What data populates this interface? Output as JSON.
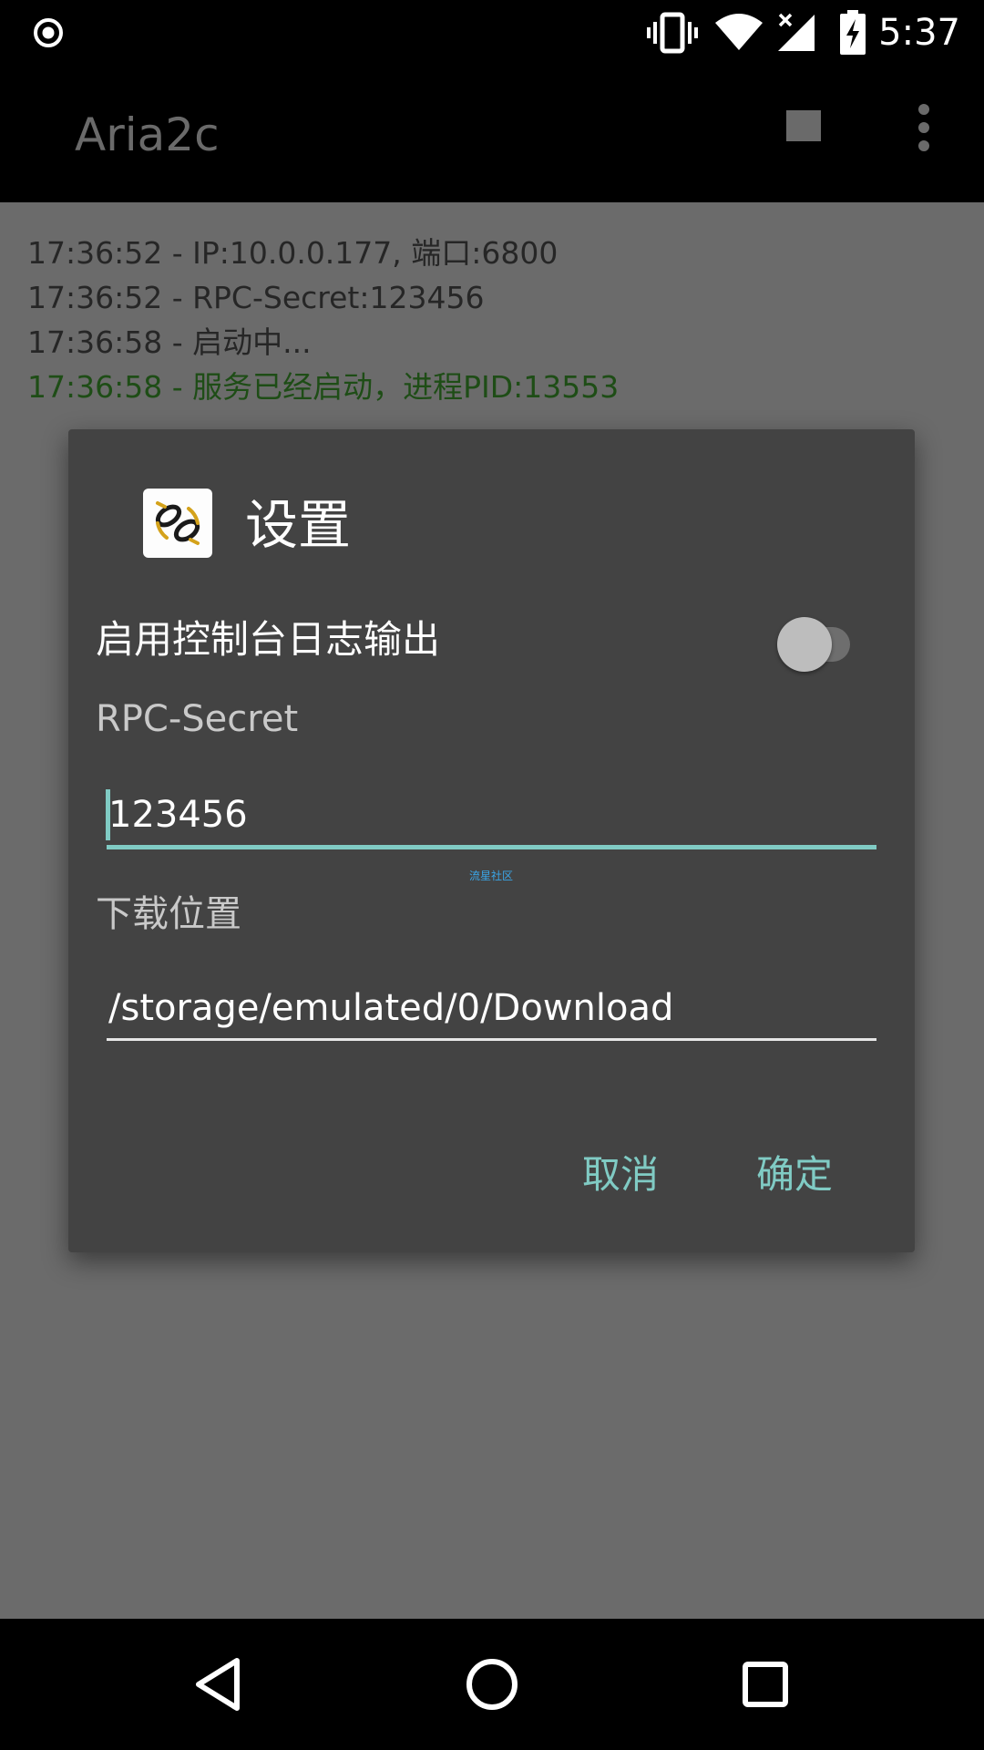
{
  "status_bar": {
    "time": "5:37",
    "icons": [
      "record-icon",
      "vibrate-icon",
      "wifi-icon",
      "signal-no-data-icon",
      "battery-charging-icon"
    ]
  },
  "toolbar": {
    "title": "Aria2c",
    "actions": [
      "stop-icon",
      "overflow-menu-icon"
    ]
  },
  "log": {
    "lines": [
      "17:36:52 - IP:10.0.0.177, 端口:6800",
      "17:36:52 - RPC-Secret:123456",
      "17:36:58 - 启动中...",
      "17:36:58 - 服务已经启动，进程PID:13553"
    ],
    "success_color": "#1e4d16"
  },
  "dialog": {
    "title": "设置",
    "console_log_label": "启用控制台日志输出",
    "console_log_enabled": false,
    "rpc_secret_label": "RPC-Secret",
    "rpc_secret_value": "123456",
    "download_location_label": "下载位置",
    "download_location_value": "/storage/emulated/0/Download",
    "watermark": "流星社区",
    "cancel_label": "取消",
    "ok_label": "确定",
    "accent_color": "#80cbc4"
  },
  "nav_bar": {
    "buttons": [
      "back-icon",
      "home-icon",
      "recents-icon"
    ]
  }
}
